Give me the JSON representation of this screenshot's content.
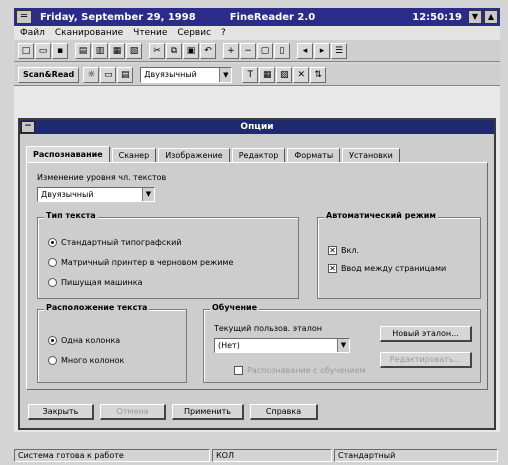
{
  "app": {
    "date_text": "Friday, September 29, 1998",
    "app_name": "FineReader 2.0",
    "clock": "12:50:19"
  },
  "menu": [
    "Файл",
    "Сканирование",
    "Чтение",
    "Сервис",
    "?"
  ],
  "toolbar2": {
    "scan_read_label": "Scan&Read",
    "mode_value": "Двуязычный"
  },
  "dialog": {
    "title": "Опции",
    "tabs": [
      "Распознавание",
      "Сканер",
      "Изображение",
      "Редактор",
      "Форматы",
      "Установки"
    ],
    "active_tab": 0,
    "text_language_label": "Изменение уровня чл. текстов",
    "text_language_value": "Двуязычный",
    "text_type": {
      "title": "Тип текста",
      "options": [
        "Стандартный типографский",
        "Матричный принтер в черновом режиме",
        "Пишущая машинка"
      ],
      "selected": 0
    },
    "auto_mode": {
      "title": "Автоматический режим",
      "options": [
        "Вкл.",
        "Ввод между страницами"
      ],
      "checked": [
        true,
        true
      ]
    },
    "text_layout": {
      "title": "Расположение текста",
      "options": [
        "Одна колонка",
        "Много колонок"
      ],
      "selected": 0
    },
    "training": {
      "title": "Обучение",
      "current_label": "Текущий пользов. эталон",
      "current_value": "(Нет)",
      "new_button": "Новый эталон...",
      "edit_button": "Редактировать...",
      "checkbox_label": "Распознавание с обучением"
    },
    "buttons": [
      "Закрыть",
      "Отмена",
      "Применить",
      "Справка"
    ]
  },
  "status": {
    "message": "Система готова к работе",
    "indicator": "КОЛ",
    "mode": "Стандартный"
  }
}
